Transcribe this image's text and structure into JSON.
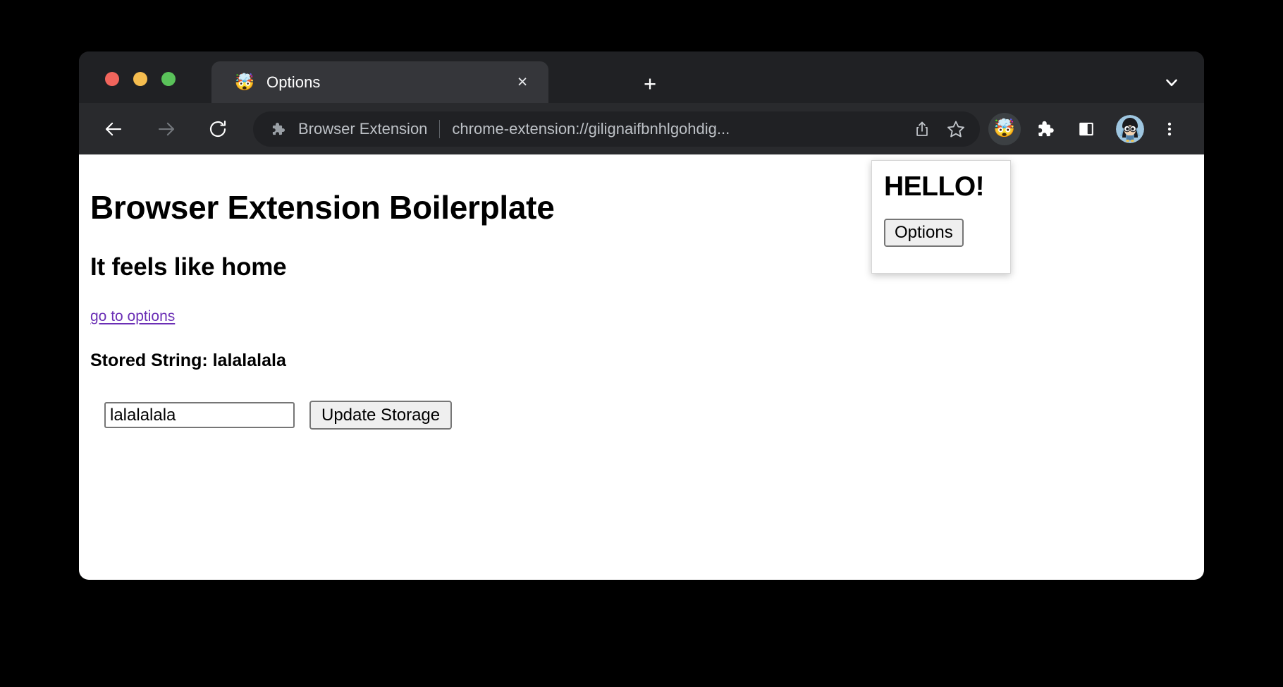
{
  "window": {
    "traffic_lights": [
      {
        "name": "close",
        "color": "#f1655c"
      },
      {
        "name": "minimize",
        "color": "#f5bd4f"
      },
      {
        "name": "maximize",
        "color": "#5ac25a"
      }
    ]
  },
  "tabstrip": {
    "tabs": [
      {
        "title": "Options",
        "favicon": "exploding-head-emoji",
        "favicon_glyph": "🤯",
        "close_glyph": "×",
        "active": true
      }
    ],
    "new_tab_glyph": "+",
    "tab_list_icon": "chevron-down-icon"
  },
  "toolbar": {
    "back_icon": "arrow-left-icon",
    "forward_icon": "arrow-right-icon",
    "reload_icon": "reload-icon",
    "omnibox": {
      "extension_icon": "puzzle-piece-icon",
      "extension_name": "Browser Extension",
      "url": "chrome-extension://gilignaifbnhlgohdig...",
      "share_icon": "share-icon",
      "bookmark_icon": "star-icon"
    },
    "actions": [
      {
        "name": "extension-action-icon",
        "glyph": "🤯",
        "active": true
      },
      {
        "name": "extensions-puzzle-icon",
        "glyph": "",
        "active": false
      },
      {
        "name": "side-panel-icon",
        "glyph": "",
        "active": false
      },
      {
        "name": "profile-avatar",
        "glyph": "",
        "active": false
      },
      {
        "name": "chrome-menu-icon",
        "glyph": "",
        "active": false
      }
    ]
  },
  "page": {
    "heading": "Browser Extension Boilerplate",
    "subheading": "It feels like home",
    "options_link": "go to options",
    "stored_string_label": "Stored String: lalalalala",
    "input_value": "lalalalala",
    "input_placeholder": "",
    "update_button": "Update Storage",
    "link_color": "#6b2fb5"
  },
  "popup": {
    "title": "HELLO!",
    "options_button": "Options"
  }
}
